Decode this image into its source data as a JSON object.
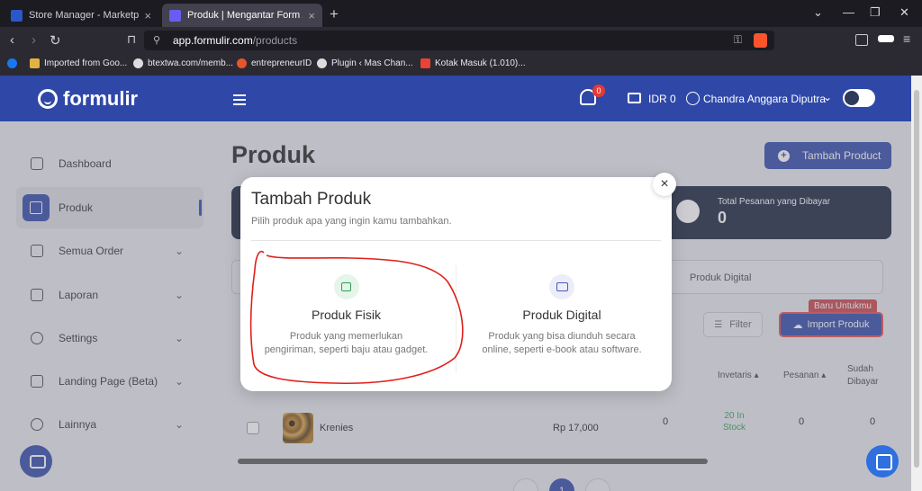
{
  "browser": {
    "tabs": [
      {
        "title": "Store Manager - Marketplace Mas C"
      },
      {
        "title": "Produk | Mengantar Form App"
      }
    ],
    "url_host": "app.formulir.com",
    "url_path": "/products",
    "bookmarks": [
      {
        "label": "Imported from Goo..."
      },
      {
        "label": "btextwa.com/memb..."
      },
      {
        "label": "entrepreneurID"
      },
      {
        "label": "Plugin ‹ Mas Chan..."
      },
      {
        "label": "Kotak Masuk (1.010)..."
      }
    ]
  },
  "header": {
    "logo": "formulir",
    "notif_count": "0",
    "currency": "IDR 0",
    "user_name": "Chandra Anggara Diputra"
  },
  "sidebar": {
    "items": [
      {
        "label": "Dashboard"
      },
      {
        "label": "Produk"
      },
      {
        "label": "Semua Order"
      },
      {
        "label": "Laporan"
      },
      {
        "label": "Settings"
      },
      {
        "label": "Landing Page (Beta)"
      },
      {
        "label": "Lainnya"
      }
    ]
  },
  "main": {
    "title": "Produk",
    "add_button": "Tambah Product",
    "stat_title": "Total Pesanan yang Dibayar",
    "stat_value": "0",
    "tab_digital": "Produk Digital",
    "new_badge": "Baru Untukmu",
    "filter_label": "Filter",
    "import_label": "Import Produk",
    "columns": {
      "inventaris": "Invetaris ▴",
      "pesanan": "Pesanan ▴",
      "sudah_dibayar_1": "Sudah",
      "sudah_dibayar_2": "Dibayar"
    },
    "row": {
      "name": "Krenies",
      "price": "Rp 17,000",
      "col_zero": "0",
      "stock_1": "20 In",
      "stock_2": "Stock",
      "pesanan": "0",
      "dibayar": "0"
    },
    "page_current": "1"
  },
  "modal": {
    "title": "Tambah Produk",
    "subtitle": "Pilih produk apa yang ingin kamu tambahkan.",
    "close": "×",
    "options": [
      {
        "title": "Produk Fisik",
        "description": "Produk yang memerlukan pengiriman, seperti baju atau gadget."
      },
      {
        "title": "Produk Digital",
        "description": "Produk yang bisa diunduh secara online, seperti e-book atau software."
      }
    ]
  },
  "colors": {
    "brand": "#2f48a8",
    "stat_bg": "#17223b",
    "stock_green": "#2e9e52",
    "annotation_red": "#e0201b"
  }
}
